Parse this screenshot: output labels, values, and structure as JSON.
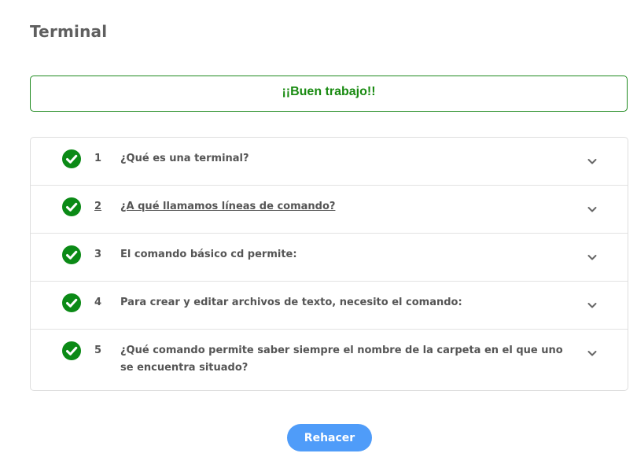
{
  "page": {
    "title": "Terminal"
  },
  "feedback": {
    "message": "¡¡Buen trabajo!!",
    "color": "#188a10"
  },
  "questions": [
    {
      "number": "1",
      "text": "¿Qué es una terminal?",
      "status": "correct",
      "icon": "check-circle-icon"
    },
    {
      "number": "2",
      "text": "¿A qué llamamos líneas de comando?",
      "status": "correct",
      "icon": "check-circle-icon"
    },
    {
      "number": "3",
      "text": "El comando básico cd permite:",
      "status": "correct",
      "icon": "check-circle-icon"
    },
    {
      "number": "4",
      "text": "Para crear y editar archivos de texto, necesito el comando:",
      "status": "correct",
      "icon": "check-circle-icon"
    },
    {
      "number": "5",
      "text": "¿Qué comando permite saber siempre el nombre de la carpeta en el que uno se encuentra situado?",
      "status": "correct",
      "icon": "check-circle-icon"
    }
  ],
  "actions": {
    "redo_label": "Rehacer"
  },
  "colors": {
    "accent": "#4f9cf9",
    "success": "#0b8a16",
    "text": "#555555"
  }
}
